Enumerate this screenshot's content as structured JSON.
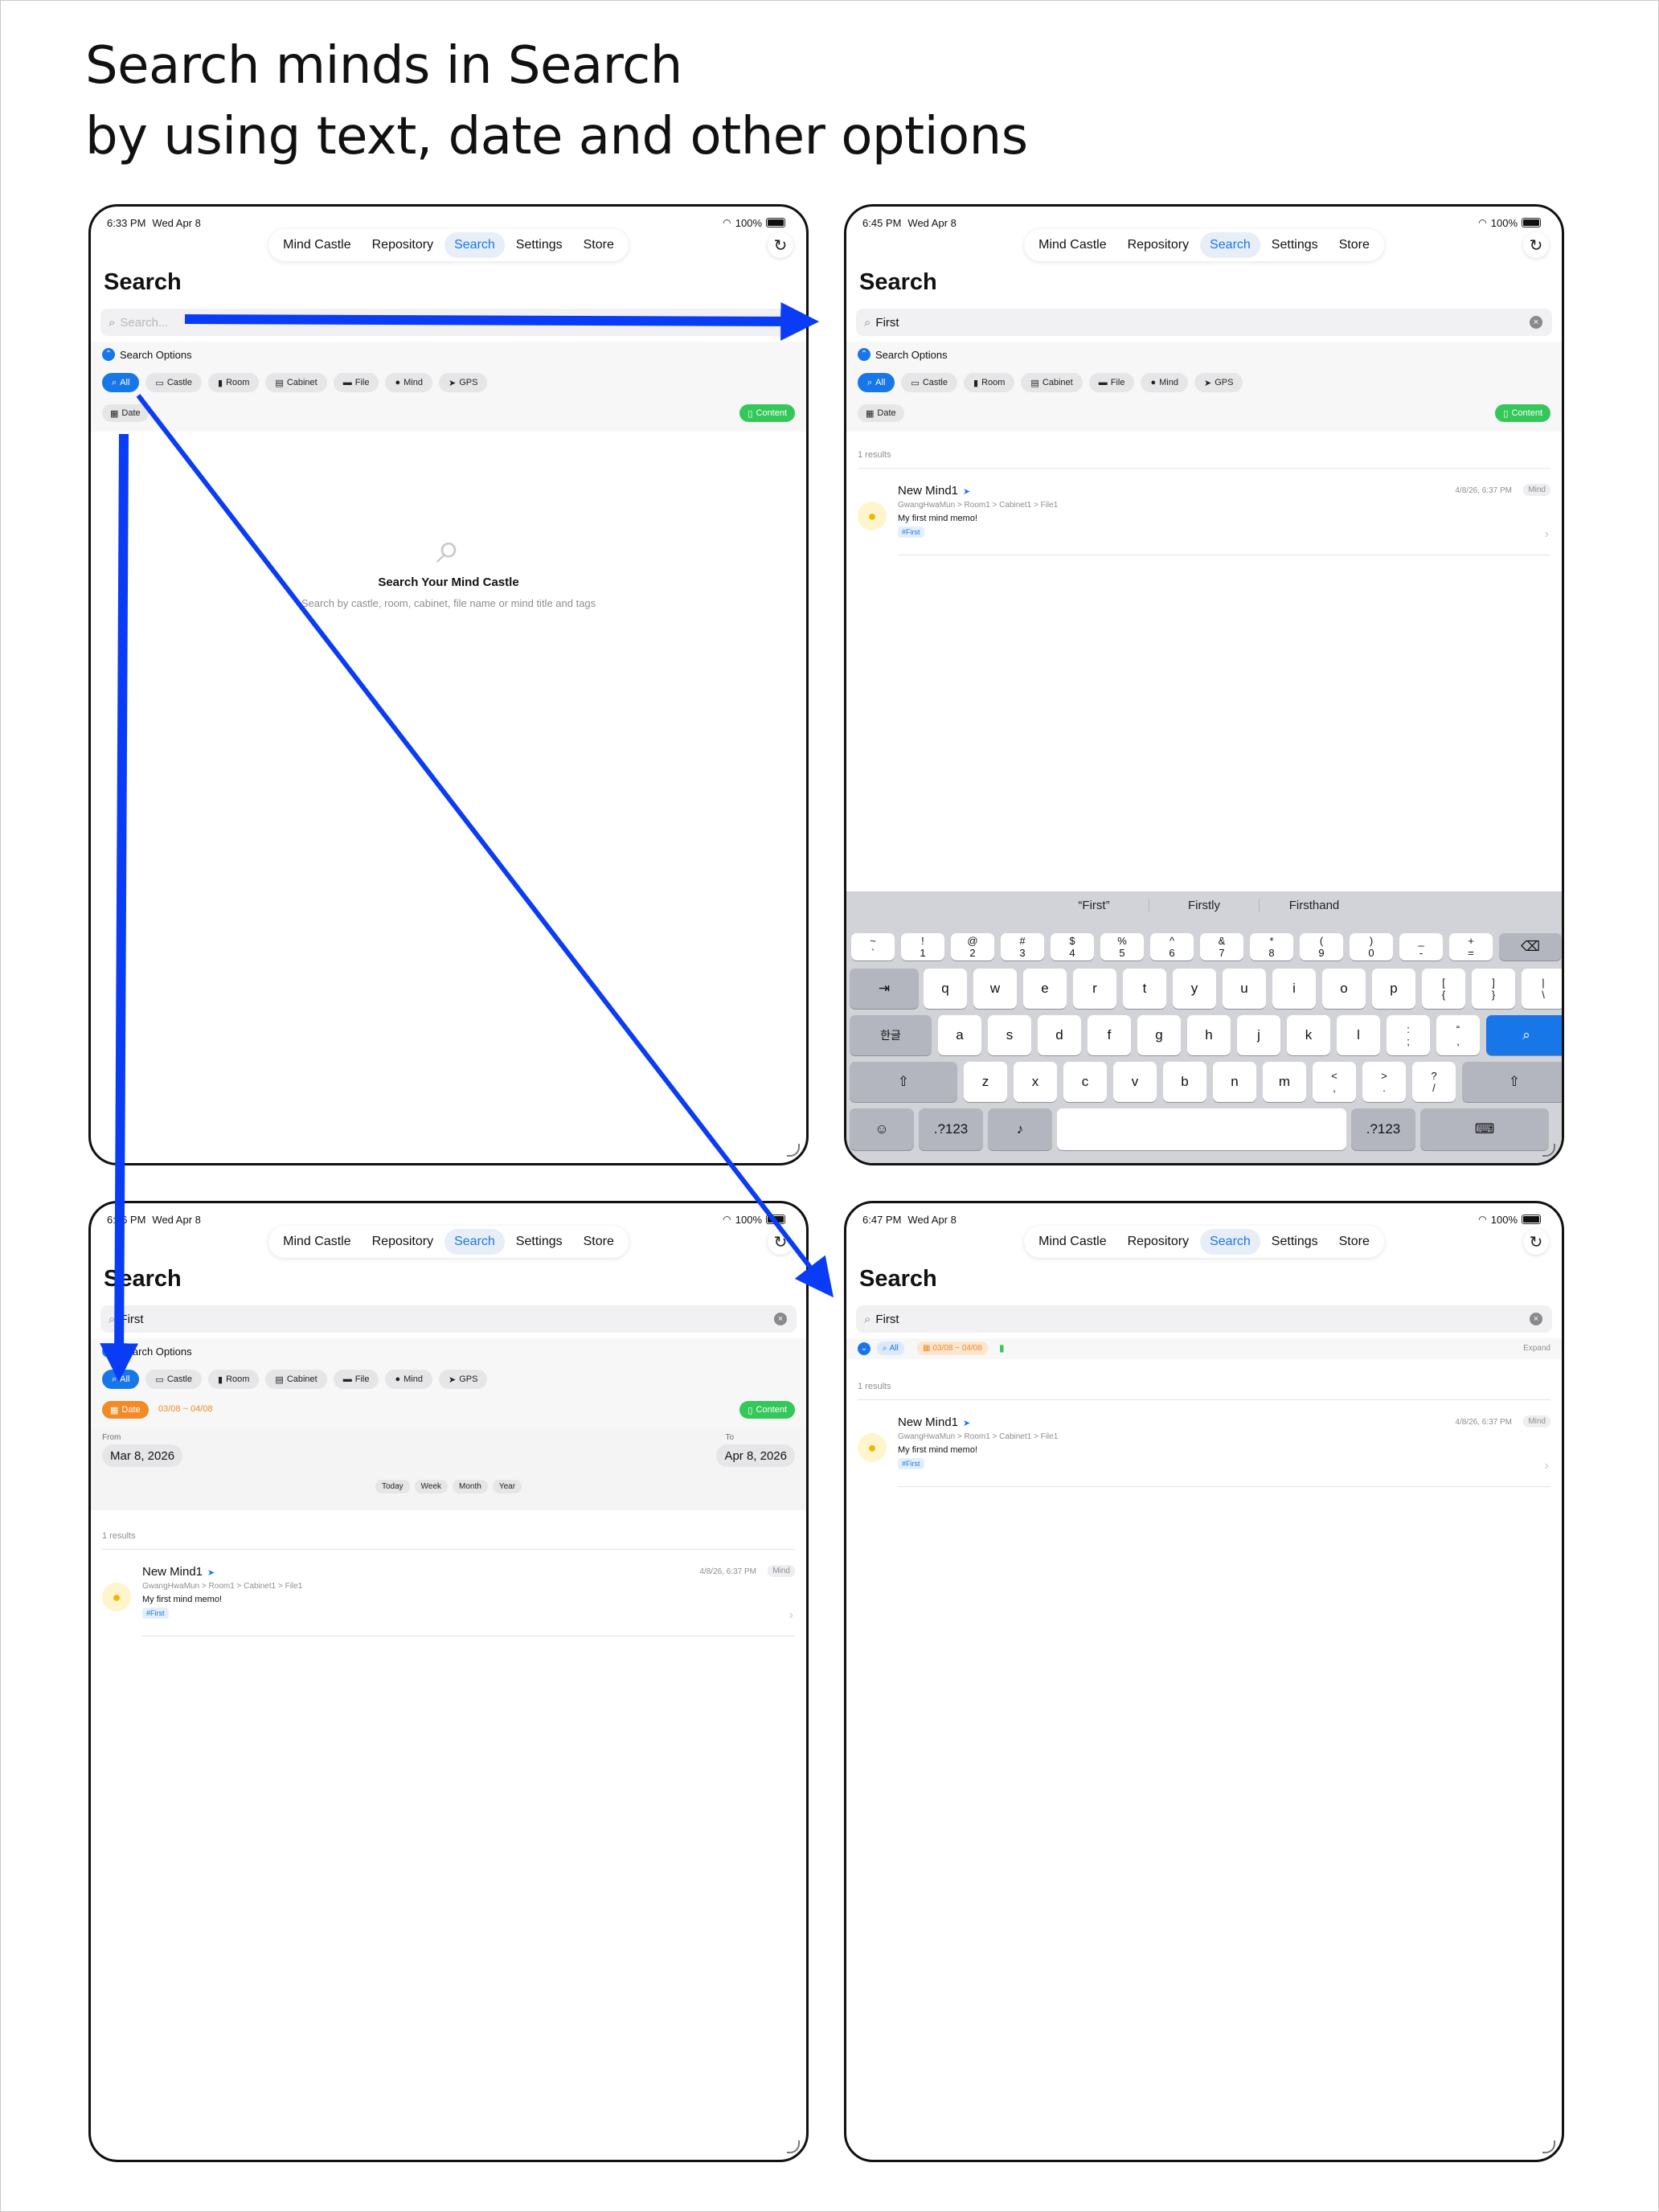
{
  "headline": [
    "Search minds in Search",
    "by using text, date and other options"
  ],
  "nav_tabs": [
    "Mind Castle",
    "Repository",
    "Search",
    "Settings",
    "Store"
  ],
  "page_title": "Search",
  "search_options_label": "Search Options",
  "filter_chips": [
    {
      "label": "All",
      "icon": "search-icon"
    },
    {
      "label": "Castle",
      "icon": "castle-icon"
    },
    {
      "label": "Room",
      "icon": "room-icon"
    },
    {
      "label": "Cabinet",
      "icon": "cabinet-icon"
    },
    {
      "label": "File",
      "icon": "folder-icon"
    },
    {
      "label": "Mind",
      "icon": "bulb-icon"
    },
    {
      "label": "GPS",
      "icon": "location-icon"
    }
  ],
  "date_label": "Date",
  "content_label": "Content",
  "date_range": "03/08 ~ 04/08",
  "battery": "100%",
  "screens": [
    {
      "time": "6:33 PM",
      "date": "Wed Apr 8",
      "search_placeholder": "Search...",
      "search_value": ""
    },
    {
      "time": "6:45 PM",
      "date": "Wed Apr 8",
      "search_value": "First"
    },
    {
      "time": "6:46 PM",
      "date": "Wed Apr 8",
      "search_value": "First"
    },
    {
      "time": "6:47 PM",
      "date": "Wed Apr 8",
      "search_value": "First"
    }
  ],
  "empty_state": {
    "title": "Search Your Mind Castle",
    "subtitle": "Search by castle, room, cabinet, file name or mind title and tags"
  },
  "results_count": "1 results",
  "result": {
    "title": "New Mind1",
    "date": "4/8/26, 6:37 PM",
    "badge": "Mind",
    "path": "GwangHwaMun > Room1 > Cabinet1 > File1",
    "memo": "My first mind memo!",
    "tag": "#First"
  },
  "date_picker": {
    "from_label": "From",
    "from_value": "Mar 8, 2026",
    "to_label": "To",
    "to_value": "Apr 8, 2026",
    "quick": [
      "Today",
      "Week",
      "Month",
      "Year"
    ]
  },
  "expand_label": "Expand",
  "keyboard": {
    "suggestions": [
      "“First”",
      "Firstly",
      "Firsthand"
    ],
    "num_row": [
      [
        "~",
        "`"
      ],
      [
        "!",
        "1"
      ],
      [
        "@",
        "2"
      ],
      [
        "#",
        "3"
      ],
      [
        "$",
        "4"
      ],
      [
        "%",
        "5"
      ],
      [
        "^",
        "6"
      ],
      [
        "&",
        "7"
      ],
      [
        "*",
        "8"
      ],
      [
        "(",
        "9"
      ],
      [
        ")",
        "0"
      ],
      [
        "_",
        "-"
      ],
      [
        "+",
        "="
      ]
    ],
    "row_q": [
      "q",
      "w",
      "e",
      "r",
      "t",
      "y",
      "u",
      "i",
      "o",
      "p"
    ],
    "row_q_extra": [
      [
        "[",
        "{"
      ],
      [
        "]",
        "}"
      ],
      [
        "|",
        "\\"
      ]
    ],
    "row_a": [
      "a",
      "s",
      "d",
      "f",
      "g",
      "h",
      "j",
      "k",
      "l"
    ],
    "row_a_extra": [
      [
        ":",
        ";"
      ],
      [
        "“",
        ","
      ]
    ],
    "row_z": [
      "z",
      "x",
      "c",
      "v",
      "b",
      "n",
      "m"
    ],
    "row_z_extra": [
      [
        "<",
        ","
      ],
      [
        ">",
        "."
      ],
      [
        "?",
        "/"
      ]
    ],
    "lang_key": "한글",
    "num_key": ".?123"
  }
}
